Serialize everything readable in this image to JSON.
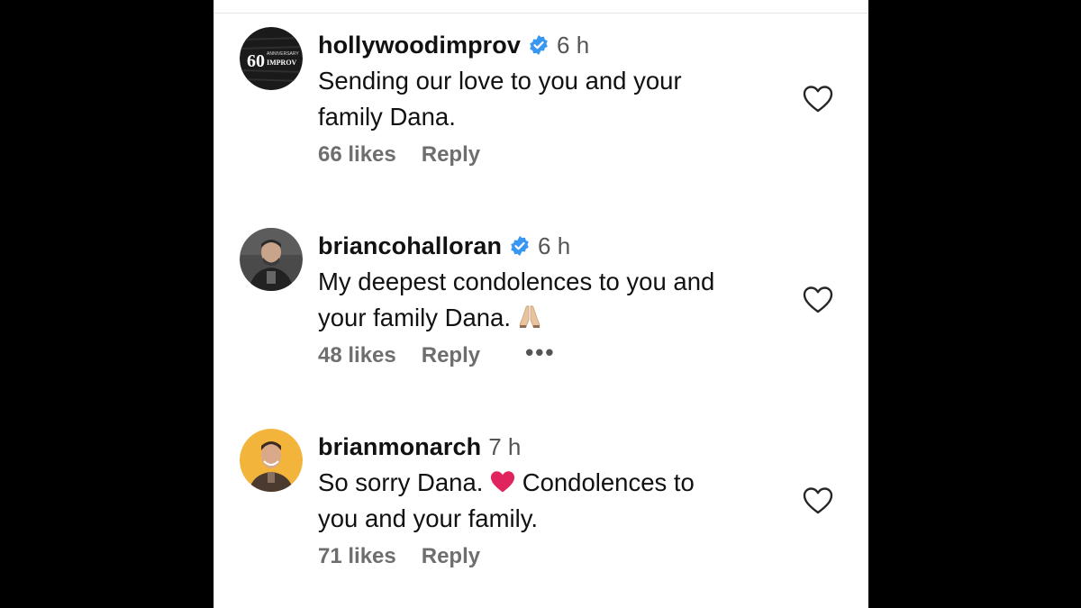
{
  "comments": [
    {
      "username": "hollywoodimprov",
      "verified": true,
      "time": "6 h",
      "text_line1": "Sending our love to you and your",
      "text_line2": "family Dana.",
      "likes": "66 likes",
      "reply": "Reply",
      "avatar_text_big": "60",
      "avatar_text_small": "IMPROV",
      "avatar_text_tiny": "ANNIVERSARY"
    },
    {
      "username": "briancohalloran",
      "verified": true,
      "time": "6 h",
      "text_line1": "My deepest condolences to you and",
      "text_line2": "your family Dana.",
      "emoji": "folded-hands-emoji",
      "likes": "48 likes",
      "reply": "Reply",
      "more": "•••"
    },
    {
      "username": "brianmonarch",
      "verified": false,
      "time": "7 h",
      "text_line1_a": "So sorry Dana.",
      "emoji": "red-heart-emoji",
      "text_line1_b": "Condolences to",
      "text_line2": "you and your family.",
      "likes": "71 likes",
      "reply": "Reply"
    }
  ],
  "colors": {
    "verified_badge": "#3897f0",
    "heart_emoji": "#e0245e",
    "avatar3_bg": "#f2b43a",
    "muted_text": "#6e6e6e"
  }
}
